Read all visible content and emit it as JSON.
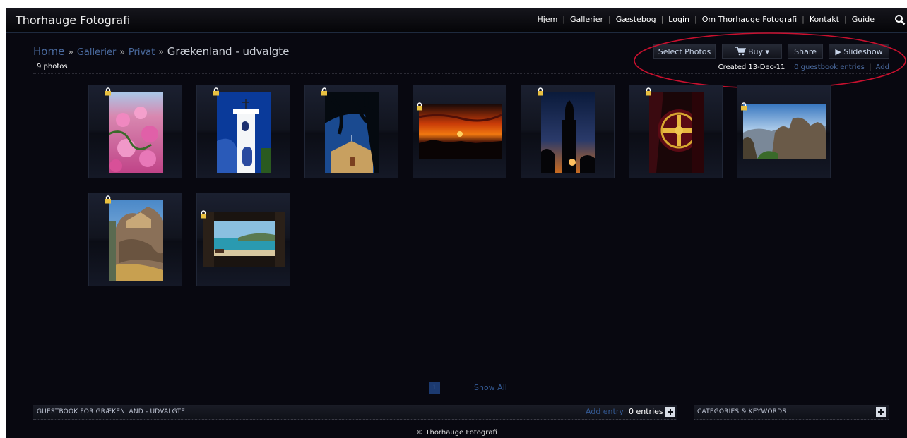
{
  "site": {
    "title": "Thorhauge Fotografi"
  },
  "nav": {
    "items": [
      "Hjem",
      "Gallerier",
      "Gæstebog",
      "Login",
      "Om Thorhauge Fotografi",
      "Kontakt",
      "Guide"
    ],
    "search_icon": "search-icon"
  },
  "breadcrumb": {
    "home": "Home",
    "separator": "»",
    "gallerier": "Gallerier",
    "privat": "Privat",
    "current": "Grækenland - udvalgte"
  },
  "gallery": {
    "photo_count": "9 photos"
  },
  "actions": {
    "select_photos": "Select Photos",
    "buy": "Buy ▾",
    "share": "Share",
    "slideshow": "▶ Slideshow",
    "buy_icon": "cart-icon"
  },
  "meta": {
    "created": "Created 13-Dec-11",
    "guestbook_entries": "0 guestbook entries",
    "separator": "|",
    "add": "Add"
  },
  "photos": [
    {
      "subject": "pink flowers",
      "icon": "lock-icon"
    },
    {
      "subject": "white bell tower",
      "icon": "lock-icon"
    },
    {
      "subject": "chapel under palm",
      "icon": "lock-icon"
    },
    {
      "subject": "sunset over sea",
      "icon": "lock-icon"
    },
    {
      "subject": "church tower silhouette",
      "icon": "lock-icon"
    },
    {
      "subject": "golden cross window",
      "icon": "lock-icon"
    },
    {
      "subject": "meteora rocks",
      "icon": "lock-icon"
    },
    {
      "subject": "monastery on rock",
      "icon": "lock-icon"
    },
    {
      "subject": "bay through window",
      "icon": "lock-icon"
    }
  ],
  "pagination": {
    "current_page": "1",
    "show_all": "Show All"
  },
  "guestbook": {
    "title": "GUESTBOOK FOR GRÆKENLAND - UDVALGTE",
    "add_entry": "Add entry",
    "entries": "0 entries"
  },
  "categories": {
    "title": "CATEGORIES & KEYWORDS"
  },
  "footer": {
    "copyright": "© Thorhauge Fotografi"
  },
  "colors": {
    "background": "#080810",
    "link": "#4a6a9e",
    "highlight": "#c8102e"
  }
}
